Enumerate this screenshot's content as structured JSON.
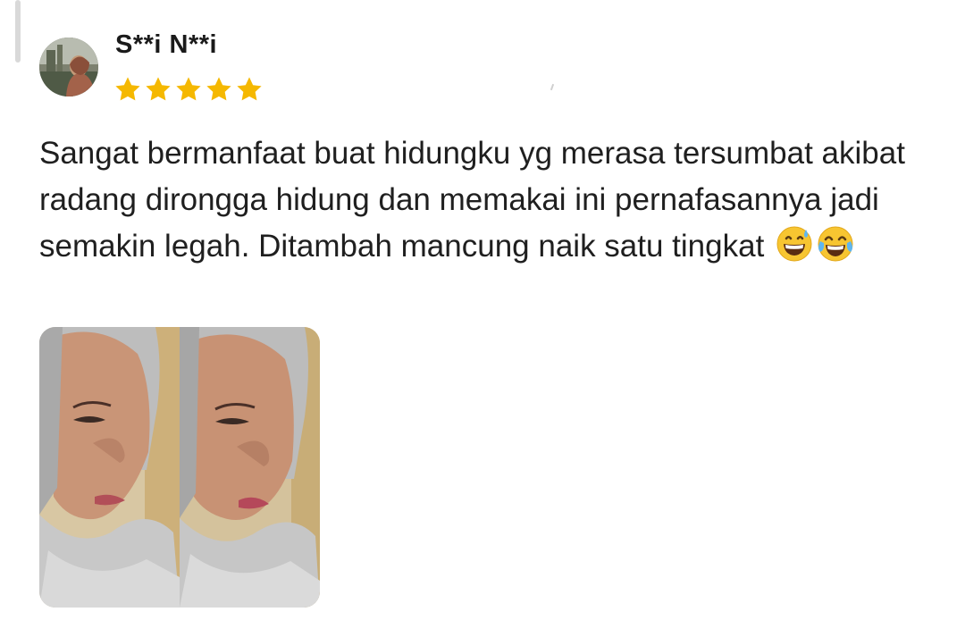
{
  "review": {
    "reviewer_name": "S**i N**i",
    "rating": 5,
    "rating_max": 5,
    "text": "Sangat bermanfaat buat hidungku yg merasa tersumbat akibat radang dirongga hidung dan memakai ini pernafasannya jadi semakin legah. Ditambah mancung naik satu tingkat",
    "emojis": [
      "grinning-sweat-emoji",
      "tears-of-joy-emoji"
    ],
    "photos": [
      {
        "subject": "side profile of woman in grey hijab"
      },
      {
        "subject": "side profile of woman in grey hijab"
      }
    ]
  },
  "colors": {
    "star": "#f5b800",
    "text": "#1f1f1f",
    "name": "#1a1a1a"
  }
}
